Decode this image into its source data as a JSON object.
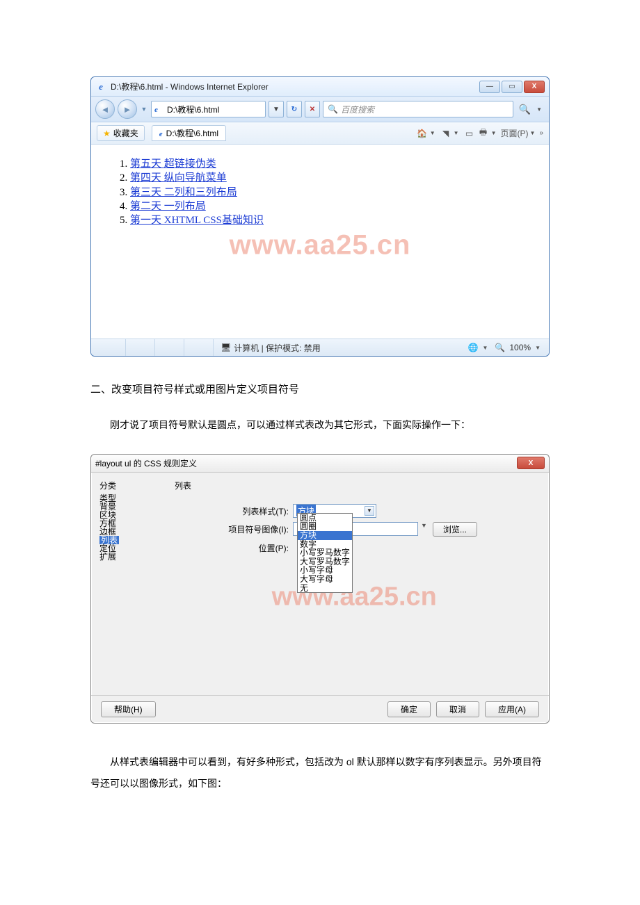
{
  "ie_window": {
    "title": "D:\\教程\\6.html - Windows Internet Explorer",
    "address": "D:\\教程\\6.html",
    "search_placeholder": "百度搜索",
    "favorites_label": "收藏夹",
    "tab_label": "D:\\教程\\6.html",
    "page_menu": "页面(P)",
    "zoom": "100%",
    "status_text": "计算机 | 保护模式: 禁用",
    "links": [
      "第五天  超链接伪类",
      "第四天  纵向导航菜单",
      "第三天  二列和三列布局",
      "第二天  一列布局",
      "第一天  XHTML CSS基础知识"
    ]
  },
  "watermark": "www.aa25.cn",
  "heading": "二、改变项目符号样式或用图片定义项目符号",
  "para1": "刚才说了项目符号默认是圆点，可以通过样式表改为其它形式，下面实际操作一下：",
  "css_dialog": {
    "title": "#layout ul 的 CSS 规则定义",
    "side_header": "分类",
    "side_items": [
      "类型",
      "背景",
      "区块",
      "方框",
      "边框",
      "列表",
      "定位",
      "扩展"
    ],
    "side_selected": "列表",
    "main_header": "列表",
    "row_list_style": "列表样式(T):",
    "list_style_value": "方块",
    "row_bullet_image": "项目符号图像(I):",
    "row_position": "位置(P):",
    "browse": "浏览...",
    "dropdown": [
      "圆点",
      "圆圈",
      "方块",
      "数字",
      "小写罗马数字",
      "大写罗马数字",
      "小写字母",
      "大写字母",
      "无"
    ],
    "dropdown_selected": "方块",
    "help": "帮助(H)",
    "ok": "确定",
    "cancel": "取消",
    "apply": "应用(A)"
  },
  "para2": "从样式表编辑器中可以看到，有好多种形式，包括改为 ol 默认那样以数字有序列表显示。另外项目符号还可以以图像形式，如下图："
}
